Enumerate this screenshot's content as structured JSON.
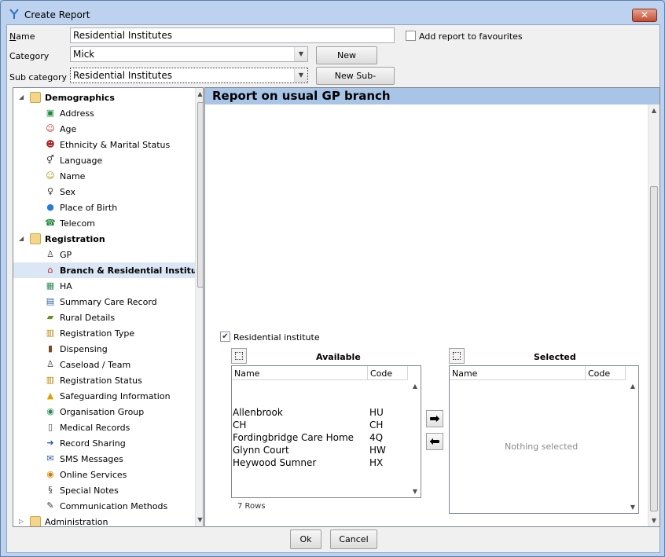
{
  "window": {
    "title": "Create Report",
    "close_glyph": "✕"
  },
  "form": {
    "name_label": "Name",
    "name_value": "Residential Institutes",
    "favourites_label": "Add report to favourites",
    "favourites_checked": false,
    "category_label": "Category",
    "category_value": "Mick",
    "new_category_label": "New Category",
    "subcategory_label": "Sub category",
    "subcategory_value": "Residential Institutes",
    "new_subcategory_label": "New Sub-category"
  },
  "tree": {
    "groups": [
      {
        "label": "Demographics",
        "expanded": true,
        "items": [
          {
            "label": "Address",
            "icon": "address-icon"
          },
          {
            "label": "Age",
            "icon": "age-icon"
          },
          {
            "label": "Ethnicity & Marital Status",
            "icon": "ethnicity-icon"
          },
          {
            "label": "Language",
            "icon": "language-icon"
          },
          {
            "label": "Name",
            "icon": "name-icon"
          },
          {
            "label": "Sex",
            "icon": "sex-icon"
          },
          {
            "label": "Place of Birth",
            "icon": "globe-icon"
          },
          {
            "label": "Telecom",
            "icon": "telephone-icon"
          }
        ]
      },
      {
        "label": "Registration",
        "expanded": true,
        "items": [
          {
            "label": "GP",
            "icon": "doctor-icon"
          },
          {
            "label": "Branch & Residential Institute",
            "icon": "house-icon",
            "selected": true
          },
          {
            "label": "HA",
            "icon": "ha-icon"
          },
          {
            "label": "Summary Care Record",
            "icon": "record-icon"
          },
          {
            "label": "Rural Details",
            "icon": "tractor-icon"
          },
          {
            "label": "Registration Type",
            "icon": "registration-type-icon"
          },
          {
            "label": "Dispensing",
            "icon": "bottle-icon"
          },
          {
            "label": "Caseload / Team",
            "icon": "team-icon"
          },
          {
            "label": "Registration Status",
            "icon": "status-icon"
          },
          {
            "label": "Safeguarding Information",
            "icon": "warning-icon"
          },
          {
            "label": "Organisation Group",
            "icon": "organisation-icon"
          },
          {
            "label": "Medical Records",
            "icon": "records-icon"
          },
          {
            "label": "Record Sharing",
            "icon": "sharing-icon"
          },
          {
            "label": "SMS Messages",
            "icon": "sms-icon"
          },
          {
            "label": "Online Services",
            "icon": "online-icon"
          },
          {
            "label": "Special Notes",
            "icon": "notes-icon"
          },
          {
            "label": "Communication Methods",
            "icon": "pen-icon"
          }
        ]
      },
      {
        "label": "Administration",
        "expanded": false,
        "items": []
      }
    ]
  },
  "report": {
    "header": "Report on usual GP branch",
    "residential_label": "Residential institute",
    "residential_checked": true,
    "available": {
      "title": "Available",
      "col_name": "Name",
      "col_code": "Code",
      "rows": [
        {
          "name": "Allenbrook",
          "code": "HU"
        },
        {
          "name": "CH",
          "code": "CH"
        },
        {
          "name": "Fordingbridge Care Home",
          "code": "4Q"
        },
        {
          "name": "Glynn Court",
          "code": "HW"
        },
        {
          "name": "Heywood Sumner",
          "code": "HX"
        }
      ],
      "row_count": "7 Rows"
    },
    "move_right_glyph": "➡",
    "move_left_glyph": "⬅",
    "selected": {
      "title": "Selected",
      "col_name": "Name",
      "col_code": "Code",
      "empty_text": "Nothing selected"
    }
  },
  "footer": {
    "ok_label": "Ok",
    "cancel_label": "Cancel"
  }
}
